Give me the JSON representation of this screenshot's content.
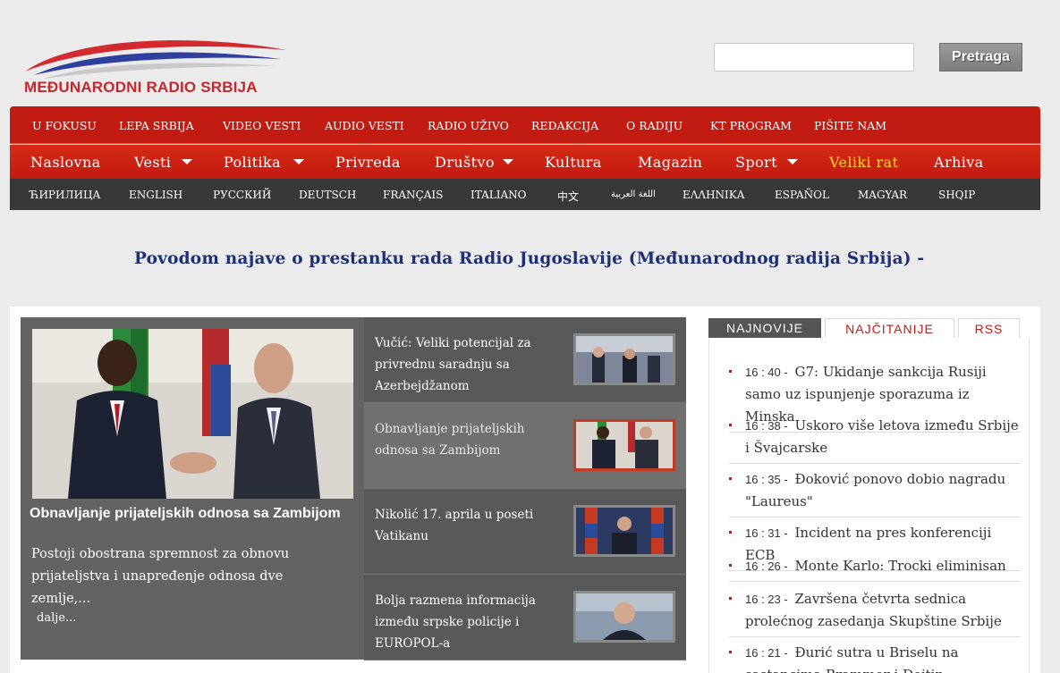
{
  "brand": {
    "logo_text": "MEĐUNARODNI RADIO SRBIJA"
  },
  "search": {
    "placeholder": "",
    "button_label": "Pretraga"
  },
  "nav_top": [
    "U FOKUSU",
    "LEPA SRBIJA",
    "VIDEO VESTI",
    "AUDIO VESTI",
    "RADIO UŽIVO",
    "REDAKCIJA",
    "O RADIJU",
    "KT PROGRAM",
    "PIŠITE NAM"
  ],
  "nav_main": [
    "Naslovna",
    "Vesti",
    "Politika",
    "Privreda",
    "Društvo",
    "Kultura",
    "Magazin",
    "Sport",
    "Veliki rat",
    "Arhiva"
  ],
  "nav_lang": [
    "ЋИРИЛИЦА",
    "ENGLISH",
    "РУССКИЙ",
    "DEUTSCH",
    "FRANÇAIS",
    "ITALIANO",
    "中文",
    "اللغة العربية",
    "ΕΛΛΗΝΙΚΑ",
    "ESPAÑOL",
    "MAGYAR",
    "SHQIP"
  ],
  "headline": "Povodom najave o prestanku rada Radio Jugoslavije (Međunarodnog radija Srbija) -",
  "feature": {
    "title": "Obnavljanje prijateljskih odnosa sa Zambijom",
    "excerpt": "Postoji obostrana spremnost za obnovu prijateljstva i unapređenje odnosa dve zemlje,...",
    "more": "dalje..."
  },
  "slides": [
    "Vučić: Veliki potencijal za privrednu saradnju sa Azerbejdžanom",
    "Obnavljanje prijateljskih odnosa sa Zambijom",
    "Nikolić 17. aprila u poseti Vatikanu",
    "Bolja razmena informacija između srpske policije i EUROPOL-a"
  ],
  "tabs": {
    "latest": "NAJNOVIJE",
    "most_read": "NAJČITANIJE",
    "rss": "RSS"
  },
  "news": [
    {
      "time": "16 : 40 -",
      "text": "G7: Ukidanje sankcija Rusiji samo uz ispunjenje sporazuma iz Minska"
    },
    {
      "time": "16 : 38 -",
      "text": "Uskoro više letova između Srbije i Švajcarske"
    },
    {
      "time": "16 : 35 -",
      "text": "Đoković ponovo dobio nagradu \"Laureus\""
    },
    {
      "time": "16 : 31 -",
      "text": "Incident na pres konferenciji ECB"
    },
    {
      "time": "16 : 26 -",
      "text": "Monte Karlo: Trocki eliminisan"
    },
    {
      "time": "16 : 23 -",
      "text": "Završena četvrta sednica prolećnog zasedanja Skupštine Srbije"
    },
    {
      "time": "16 : 21 -",
      "text": "Đurić sutra u Briselu na sastancima Brammer i Dejtin..."
    }
  ]
}
